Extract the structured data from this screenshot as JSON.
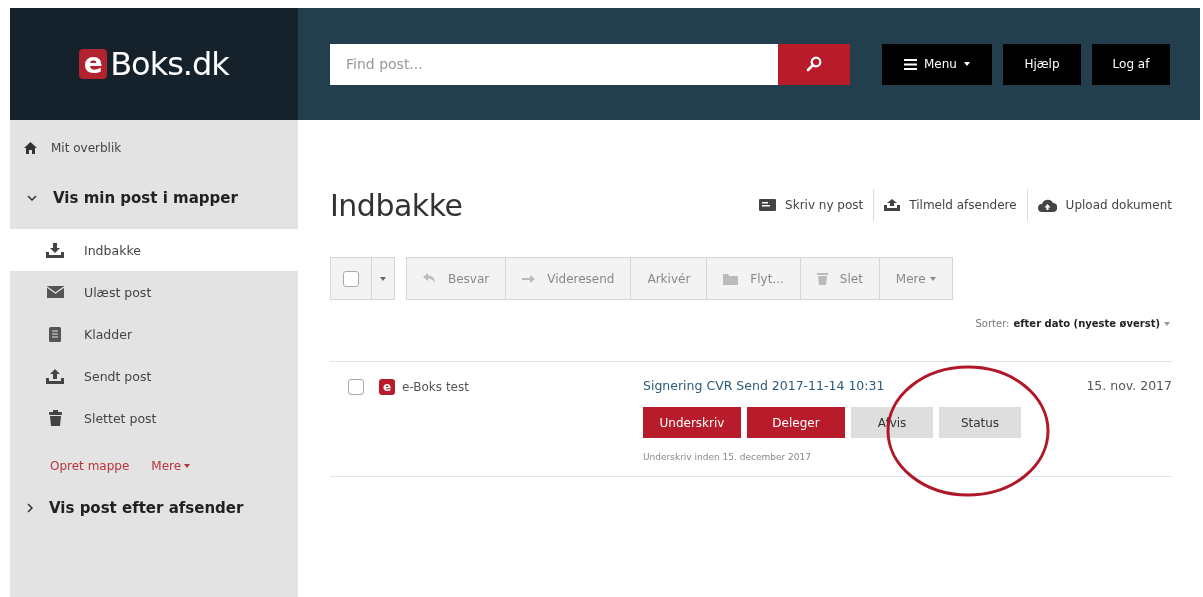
{
  "header": {
    "logo_mark": "e",
    "logo_text": "Boks.dk",
    "search": {
      "placeholder": "Find post..."
    },
    "buttons": [
      {
        "label": "Menu",
        "kind": "menu"
      },
      {
        "label": "Hjælp",
        "kind": "plain"
      },
      {
        "label": "Log af",
        "kind": "plain"
      }
    ]
  },
  "sidebar": {
    "overview": "Mit overblik",
    "sections": [
      {
        "title": "Vis min post i mapper",
        "expanded": true,
        "items": [
          {
            "label": "Indbakke",
            "selected": true
          },
          {
            "label": "Ulæst post",
            "selected": false
          },
          {
            "label": "Kladder",
            "selected": false
          },
          {
            "label": "Sendt post",
            "selected": false
          },
          {
            "label": "Slettet post",
            "selected": false
          }
        ],
        "links": [
          "Opret mappe",
          "Mere"
        ]
      },
      {
        "title": "Vis post efter afsender",
        "expanded": false
      }
    ]
  },
  "main": {
    "title": "Indbakke",
    "actions": [
      "Skriv ny post",
      "Tilmeld afsendere",
      "Upload dokument"
    ],
    "toolbar": {
      "select_all_checked": false,
      "buttons": [
        "Besvar",
        "Videresend",
        "Arkivér",
        "Flyt...",
        "Slet",
        "Mere"
      ]
    },
    "sort": {
      "label": "Sorter:",
      "value": "efter dato (nyeste øverst)"
    },
    "messages": [
      {
        "checked": false,
        "sender_mark": "e",
        "sender": "e-Boks test",
        "subject": "Signering CVR Send 2017-11-14 10:31",
        "date": "15. nov. 2017",
        "buttons": [
          {
            "label": "Underskriv",
            "kind": "primary"
          },
          {
            "label": "Deleger",
            "kind": "primary"
          },
          {
            "label": "Afvis",
            "kind": "secondary"
          },
          {
            "label": "Status",
            "kind": "secondary"
          }
        ],
        "note": "Underskriv inden 15. december 2017"
      }
    ]
  },
  "annotation": {
    "kind": "circle"
  }
}
